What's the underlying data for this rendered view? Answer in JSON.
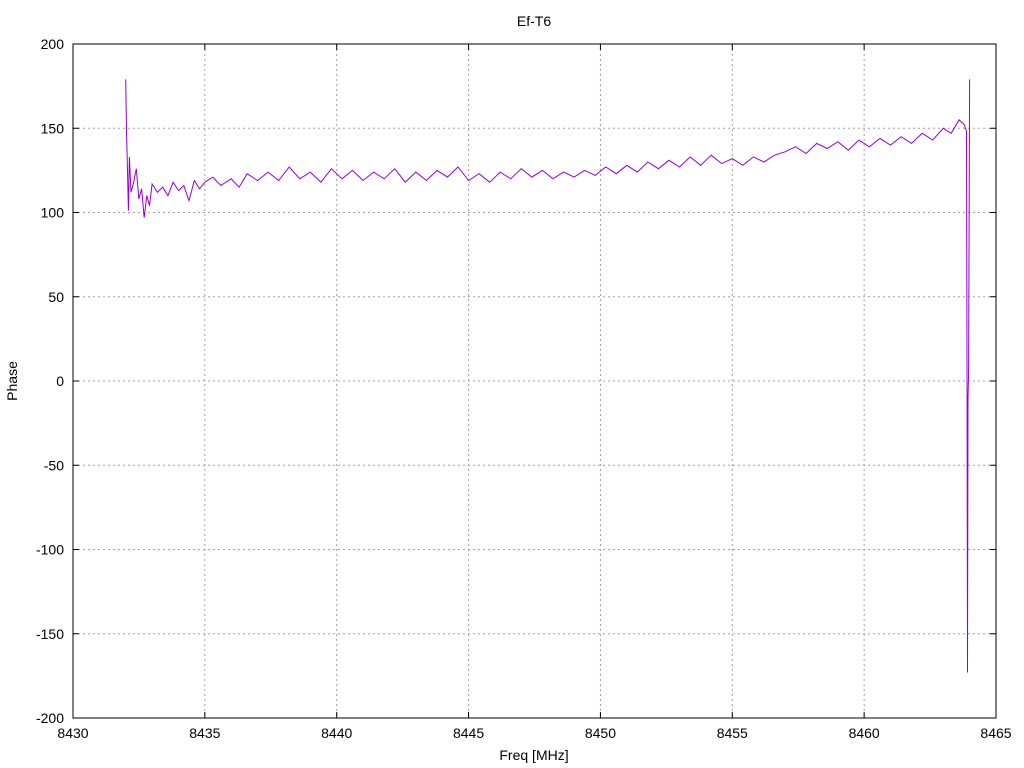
{
  "chart_data": {
    "type": "line",
    "title": "Ef-T6",
    "xlabel": "Freq [MHz]",
    "ylabel": "Phase",
    "xlim": [
      8430,
      8465
    ],
    "ylim": [
      -200,
      200
    ],
    "xticks": [
      8430,
      8435,
      8440,
      8445,
      8450,
      8455,
      8460,
      8465
    ],
    "yticks": [
      -200,
      -150,
      -100,
      -50,
      0,
      50,
      100,
      150,
      200
    ],
    "grid": true,
    "legend": "none",
    "series": [
      {
        "color": "#9400d3",
        "points": [
          [
            8432.0,
            179
          ],
          [
            8432.03,
            148
          ],
          [
            8432.06,
            130
          ],
          [
            8432.1,
            101
          ],
          [
            8432.14,
            133
          ],
          [
            8432.2,
            112
          ],
          [
            8432.3,
            118
          ],
          [
            8432.4,
            126
          ],
          [
            8432.5,
            108
          ],
          [
            8432.6,
            114
          ],
          [
            8432.7,
            97
          ],
          [
            8432.8,
            110
          ],
          [
            8432.9,
            104
          ],
          [
            8433.0,
            117
          ],
          [
            8433.2,
            112
          ],
          [
            8433.4,
            115
          ],
          [
            8433.6,
            110
          ],
          [
            8433.8,
            118
          ],
          [
            8434.0,
            113
          ],
          [
            8434.2,
            116
          ],
          [
            8434.4,
            107
          ],
          [
            8434.6,
            119
          ],
          [
            8434.8,
            114
          ],
          [
            8435.0,
            118
          ],
          [
            8435.3,
            121
          ],
          [
            8435.6,
            116
          ],
          [
            8436.0,
            120
          ],
          [
            8436.3,
            115
          ],
          [
            8436.6,
            123
          ],
          [
            8437.0,
            119
          ],
          [
            8437.4,
            124
          ],
          [
            8437.8,
            119
          ],
          [
            8438.2,
            127
          ],
          [
            8438.6,
            120
          ],
          [
            8439.0,
            124
          ],
          [
            8439.4,
            118
          ],
          [
            8439.8,
            126
          ],
          [
            8440.2,
            120
          ],
          [
            8440.6,
            125
          ],
          [
            8441.0,
            119
          ],
          [
            8441.4,
            124
          ],
          [
            8441.8,
            120
          ],
          [
            8442.2,
            126
          ],
          [
            8442.6,
            118
          ],
          [
            8443.0,
            124
          ],
          [
            8443.4,
            119
          ],
          [
            8443.8,
            125
          ],
          [
            8444.2,
            121
          ],
          [
            8444.6,
            127
          ],
          [
            8445.0,
            119
          ],
          [
            8445.4,
            123
          ],
          [
            8445.8,
            118
          ],
          [
            8446.2,
            124
          ],
          [
            8446.6,
            120
          ],
          [
            8447.0,
            126
          ],
          [
            8447.4,
            121
          ],
          [
            8447.8,
            125
          ],
          [
            8448.2,
            120
          ],
          [
            8448.6,
            124
          ],
          [
            8449.0,
            121
          ],
          [
            8449.4,
            125
          ],
          [
            8449.8,
            122
          ],
          [
            8450.2,
            127
          ],
          [
            8450.6,
            123
          ],
          [
            8451.0,
            128
          ],
          [
            8451.4,
            124
          ],
          [
            8451.8,
            130
          ],
          [
            8452.2,
            126
          ],
          [
            8452.6,
            131
          ],
          [
            8453.0,
            127
          ],
          [
            8453.4,
            133
          ],
          [
            8453.8,
            128
          ],
          [
            8454.2,
            134
          ],
          [
            8454.6,
            129
          ],
          [
            8455.0,
            132
          ],
          [
            8455.4,
            128
          ],
          [
            8455.8,
            133
          ],
          [
            8456.2,
            130
          ],
          [
            8456.6,
            134
          ],
          [
            8457.0,
            136
          ],
          [
            8457.4,
            139
          ],
          [
            8457.8,
            135
          ],
          [
            8458.2,
            141
          ],
          [
            8458.6,
            138
          ],
          [
            8459.0,
            142
          ],
          [
            8459.4,
            137
          ],
          [
            8459.8,
            143
          ],
          [
            8460.2,
            139
          ],
          [
            8460.6,
            144
          ],
          [
            8461.0,
            140
          ],
          [
            8461.4,
            145
          ],
          [
            8461.8,
            141
          ],
          [
            8462.2,
            147
          ],
          [
            8462.6,
            143
          ],
          [
            8463.0,
            150
          ],
          [
            8463.3,
            147
          ],
          [
            8463.6,
            155
          ],
          [
            8463.8,
            152
          ],
          [
            8463.88,
            148
          ],
          [
            8463.9,
            10
          ],
          [
            8463.92,
            -173
          ],
          [
            8463.94,
            -10
          ],
          [
            8463.96,
            5
          ],
          [
            8464.0,
            179
          ]
        ]
      }
    ]
  }
}
